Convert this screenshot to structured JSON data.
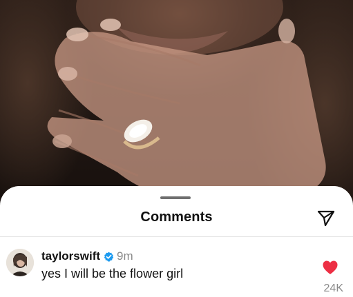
{
  "sheet": {
    "title": "Comments"
  },
  "icons": {
    "share": "paper-plane-icon",
    "verified": "verified-badge-icon",
    "like": "heart-icon"
  },
  "colors": {
    "like_active": "#ed2f44",
    "verified": "#1d9bf0",
    "secondary_text": "#8a8a8a"
  },
  "comments": [
    {
      "username": "taylorswift",
      "verified": true,
      "time": "9m",
      "text": "yes I will be the flower girl",
      "liked": true,
      "like_count": "24K"
    }
  ]
}
